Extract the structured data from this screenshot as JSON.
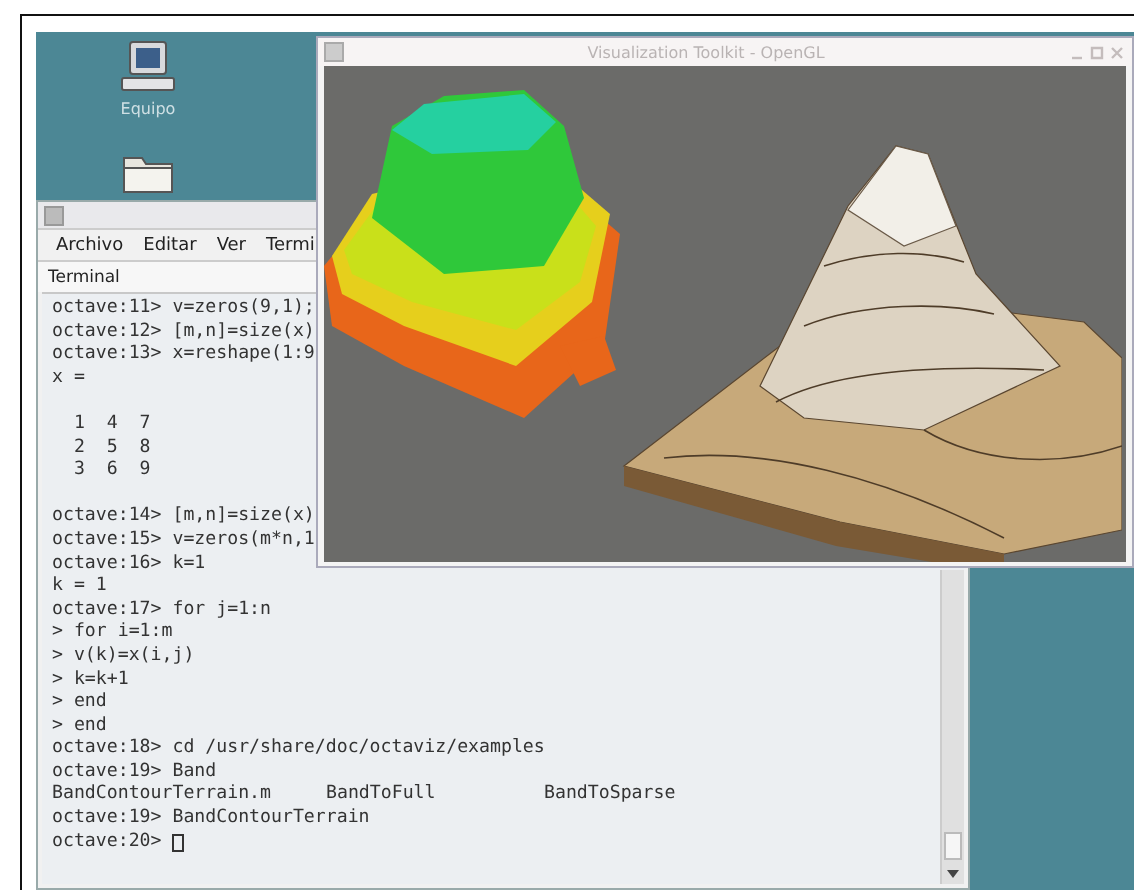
{
  "desktop_icons": [
    {
      "kind": "computer",
      "label": "Equipo"
    },
    {
      "kind": "folder"
    }
  ],
  "terminal": {
    "menu": [
      "Archivo",
      "Editar",
      "Ver",
      "Termi"
    ],
    "tab": "Terminal",
    "lines": [
      {
        "kind": "text",
        "text": "octave:11> v=zeros(9,1);"
      },
      {
        "kind": "text",
        "text": "octave:12> [m,n]=size(x)"
      },
      {
        "kind": "text",
        "text": "octave:13> x=reshape(1:9"
      },
      {
        "kind": "text",
        "text": "x ="
      },
      {
        "kind": "blank"
      },
      {
        "kind": "text",
        "text": "  1  4  7"
      },
      {
        "kind": "text",
        "text": "  2  5  8"
      },
      {
        "kind": "text",
        "text": "  3  6  9"
      },
      {
        "kind": "blank"
      },
      {
        "kind": "text",
        "text": "octave:14> [m,n]=size(x)"
      },
      {
        "kind": "text",
        "text": "octave:15> v=zeros(m*n,1"
      },
      {
        "kind": "text",
        "text": "octave:16> k=1"
      },
      {
        "kind": "text",
        "text": "k = 1"
      },
      {
        "kind": "text",
        "text": "octave:17> for j=1:n"
      },
      {
        "kind": "text",
        "text": "> for i=1:m"
      },
      {
        "kind": "text",
        "text": "> v(k)=x(i,j)"
      },
      {
        "kind": "text",
        "text": "> k=k+1"
      },
      {
        "kind": "text",
        "text": "> end"
      },
      {
        "kind": "text",
        "text": "> end"
      },
      {
        "kind": "text",
        "text": "octave:18> cd /usr/share/doc/octaviz/examples"
      },
      {
        "kind": "text",
        "text": "octave:19> Band"
      },
      {
        "kind": "columns",
        "cells": [
          "BandContourTerrain.m",
          "BandToFull",
          "BandToSparse"
        ]
      },
      {
        "kind": "text",
        "text": "octave:19> BandContourTerrain"
      },
      {
        "kind": "prompt",
        "text": "octave:20> "
      }
    ]
  },
  "render_window": {
    "title": "Visualization Toolkit - OpenGL"
  }
}
